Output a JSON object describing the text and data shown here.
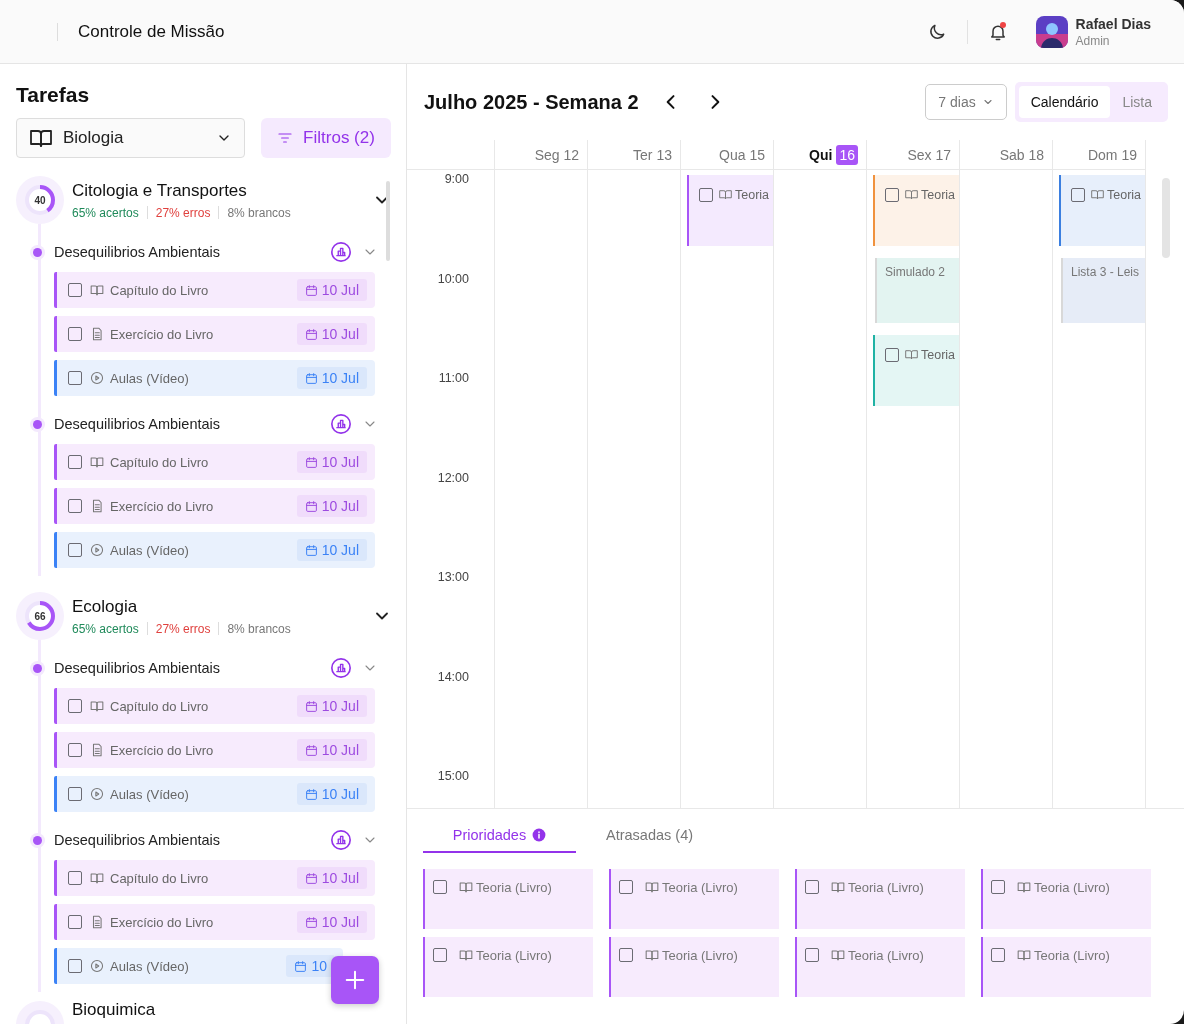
{
  "header": {
    "title": "Controle de Missão",
    "notifications": {
      "unread": true
    },
    "user": {
      "name": "Rafael Dias",
      "role": "Admin"
    }
  },
  "sidebar": {
    "title": "Tarefas",
    "subject": "Biologia",
    "filter_button": "Filtros (2)",
    "groups": [
      {
        "score": "40",
        "level": 0.4,
        "title": "Citologia e Transportes",
        "expanded": true,
        "stats": [
          {
            "kind": "correct",
            "text": "65% acertos"
          },
          {
            "kind": "wrong",
            "text": "27% erros"
          },
          {
            "kind": "blank",
            "text": "8% brancos"
          }
        ],
        "topics": [
          {
            "title": "Desequilibrios Ambientais",
            "expanded": true,
            "tasks": [
              {
                "kind": "book",
                "label": "Capítulo do Livro",
                "date": "10 Jul",
                "checked": false
              },
              {
                "kind": "exercise",
                "label": "Exercício do Livro",
                "date": "10 Jul",
                "checked": false
              },
              {
                "kind": "video",
                "label": "Aulas (Vídeo)",
                "date": "10 Jul",
                "checked": false
              }
            ]
          },
          {
            "title": "Desequilibrios Ambientais",
            "expanded": true,
            "tasks": [
              {
                "kind": "book",
                "label": "Capítulo do Livro",
                "date": "10 Jul",
                "checked": false
              },
              {
                "kind": "exercise",
                "label": "Exercício do Livro",
                "date": "10 Jul",
                "checked": false
              },
              {
                "kind": "video",
                "label": "Aulas (Vídeo)",
                "date": "10 Jul",
                "checked": false
              }
            ]
          }
        ]
      },
      {
        "score": "66",
        "level": 0.66,
        "title": "Ecologia",
        "expanded": true,
        "stats": [
          {
            "kind": "correct",
            "text": "65% acertos"
          },
          {
            "kind": "wrong",
            "text": "27% erros"
          },
          {
            "kind": "blank",
            "text": "8% brancos"
          }
        ],
        "topics": [
          {
            "title": "Desequilibrios Ambientais",
            "expanded": true,
            "tasks": [
              {
                "kind": "book",
                "label": "Capítulo do Livro",
                "date": "10 Jul",
                "checked": false
              },
              {
                "kind": "exercise",
                "label": "Exercício do Livro",
                "date": "10 Jul",
                "checked": false
              },
              {
                "kind": "video",
                "label": "Aulas (Vídeo)",
                "date": "10 Jul",
                "checked": false
              }
            ]
          },
          {
            "title": "Desequilibrios Ambientais",
            "expanded": true,
            "tasks": [
              {
                "kind": "book",
                "label": "Capítulo do Livro",
                "date": "10 Jul",
                "checked": false
              },
              {
                "kind": "exercise",
                "label": "Exercício do Livro",
                "date": "10 Jul",
                "checked": false
              },
              {
                "kind": "video",
                "label": "Aulas (Vídeo)",
                "date": "10",
                "checked": false
              }
            ]
          }
        ]
      },
      {
        "title": "Bioquimica"
      }
    ]
  },
  "calendar": {
    "title": "Julho 2025 - Semana 2",
    "range": "7 dias",
    "views": [
      {
        "label": "Calendário",
        "selected": true
      },
      {
        "label": "Lista",
        "selected": false
      }
    ],
    "hours": [
      "9:00",
      "10:00",
      "11:00",
      "12:00",
      "13:00",
      "14:00",
      "15:00"
    ],
    "days": [
      {
        "weekday": "Seg",
        "day": "12",
        "today": false
      },
      {
        "weekday": "Ter",
        "day": "13",
        "today": false
      },
      {
        "weekday": "Qua",
        "day": "15",
        "today": false,
        "events": [
          {
            "title": "Teoria",
            "color": "#a855f7",
            "done": false,
            "checked": false
          }
        ]
      },
      {
        "weekday": "Qui",
        "day": "16",
        "today": true
      },
      {
        "weekday": "Sex",
        "day": "17",
        "today": false,
        "events": [
          {
            "title": "Teoria",
            "color": "#f0923e",
            "done": false,
            "checked": false
          },
          {
            "title": "Simulado 2",
            "color": "#e3f4f1",
            "done": true
          },
          {
            "title": "Teoria",
            "color": "#20b2a4",
            "done": false,
            "checked": false
          }
        ]
      },
      {
        "weekday": "Sab",
        "day": "18",
        "today": false
      },
      {
        "weekday": "Dom",
        "day": "19",
        "today": false,
        "events": [
          {
            "title": "Teoria",
            "color": "#3b7fe0",
            "done": false,
            "checked": false
          },
          {
            "title": "Lista 3 - Leis",
            "color": "#e6ecf7",
            "done": true
          }
        ]
      }
    ]
  },
  "bottom": {
    "tabs": [
      {
        "label": "Prioridades",
        "selected": true,
        "info": true
      },
      {
        "label": "Atrasadas (4)",
        "selected": false,
        "info": false
      }
    ],
    "cards": [
      {
        "kind": "book",
        "label": "Teoria (Livro)",
        "checked": false
      },
      {
        "kind": "book",
        "label": "Teoria (Livro)",
        "checked": false
      },
      {
        "kind": "book",
        "label": "Teoria (Livro)",
        "checked": false
      },
      {
        "kind": "book",
        "label": "Teoria (Livro)",
        "checked": false
      },
      {
        "kind": "book",
        "label": "Teoria (Livro)",
        "checked": false
      },
      {
        "kind": "book",
        "label": "Teoria (Livro)",
        "checked": false
      },
      {
        "kind": "book",
        "label": "Teoria (Livro)",
        "checked": false
      },
      {
        "kind": "book",
        "label": "Teoria (Livro)",
        "checked": false
      }
    ]
  }
}
